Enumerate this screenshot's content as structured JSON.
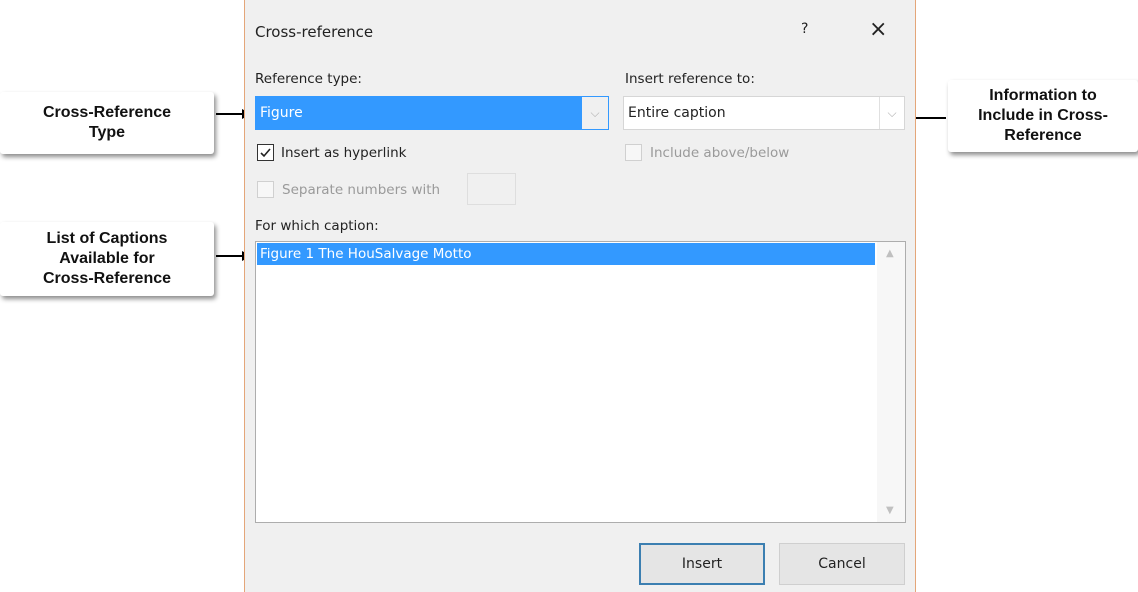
{
  "dialog": {
    "title": "Cross-reference",
    "help": "?",
    "close": "×",
    "reference_type": {
      "label": "Reference type:",
      "value": "Figure"
    },
    "insert_reference_to": {
      "label": "Insert reference to:",
      "value": "Entire caption"
    },
    "insert_as_hyperlink": {
      "label": "Insert as hyperlink",
      "checked": true
    },
    "include_above_below": {
      "label": "Include above/below",
      "checked": false
    },
    "separate_numbers": {
      "label": "Separate numbers with",
      "checked": false,
      "value": ""
    },
    "for_which_caption": {
      "label": "For which caption:",
      "items": [
        "Figure 1 The HouSalvage Motto"
      ],
      "selected": 0
    },
    "buttons": {
      "insert": "Insert",
      "cancel": "Cancel"
    }
  },
  "callouts": {
    "type": [
      "Cross-Reference",
      "Type"
    ],
    "info": [
      "Information to",
      "Include in Cross-",
      "Reference"
    ],
    "list": [
      "List of Captions",
      "Available for",
      "Cross-Reference"
    ]
  },
  "colors": {
    "selection": "#3399ff",
    "accent_border": "#e4a679",
    "default_button_border": "#3c7fb1"
  }
}
